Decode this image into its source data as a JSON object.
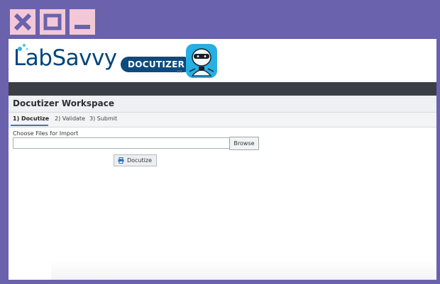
{
  "window_controls": {
    "close": "close",
    "maximize": "maximize",
    "minimize": "minimize"
  },
  "header": {
    "logo_text": "LabSavvy",
    "product_badge": "DOCUTIZER",
    "trademark": "TM",
    "mascot": "robot-mascot"
  },
  "workspace": {
    "title": "Docutizer Workspace"
  },
  "tabs": [
    {
      "label": "1) Docutize",
      "active": true
    },
    {
      "label": "2) Validate",
      "active": false
    },
    {
      "label": "3) Submit",
      "active": false
    }
  ],
  "form": {
    "files_label": "Choose Files for Import",
    "file_value": "",
    "browse_label": "Browse",
    "docutize_label": "Docutize"
  },
  "colors": {
    "frame": "#6a62ad",
    "window_button": "#f3c8d6",
    "brand_blue": "#0d4a7d",
    "dark_bar": "#3a3e45",
    "tab_accent": "#3a78c2"
  }
}
